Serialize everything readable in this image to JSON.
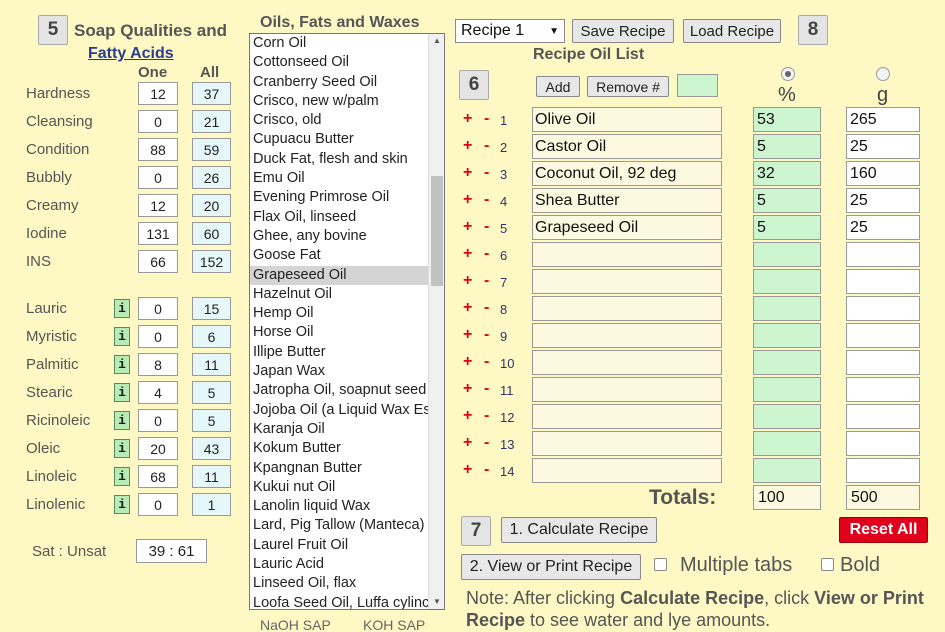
{
  "qualities": {
    "step": "5",
    "title_line1": "Soap Qualities and",
    "title_link": "Fatty Acids",
    "col_one": "One",
    "col_all": "All",
    "rows": [
      {
        "label": "Hardness",
        "one": "12",
        "all": "37"
      },
      {
        "label": "Cleansing",
        "one": "0",
        "all": "21"
      },
      {
        "label": "Condition",
        "one": "88",
        "all": "59"
      },
      {
        "label": "Bubbly",
        "one": "0",
        "all": "26"
      },
      {
        "label": "Creamy",
        "one": "12",
        "all": "20"
      },
      {
        "label": "Iodine",
        "one": "131",
        "all": "60"
      },
      {
        "label": "INS",
        "one": "66",
        "all": "152"
      }
    ],
    "acids": [
      {
        "label": "Lauric",
        "one": "0",
        "all": "15"
      },
      {
        "label": "Myristic",
        "one": "0",
        "all": "6"
      },
      {
        "label": "Palmitic",
        "one": "8",
        "all": "11"
      },
      {
        "label": "Stearic",
        "one": "4",
        "all": "5"
      },
      {
        "label": "Ricinoleic",
        "one": "0",
        "all": "5"
      },
      {
        "label": "Oleic",
        "one": "20",
        "all": "43"
      },
      {
        "label": "Linoleic",
        "one": "68",
        "all": "11"
      },
      {
        "label": "Linolenic",
        "one": "0",
        "all": "1"
      }
    ],
    "info_label": "i",
    "sat_label": "Sat : Unsat",
    "sat_value": "39 : 61"
  },
  "oils": {
    "title": "Oils, Fats and Waxes",
    "items": [
      "Corn Oil",
      "Cottonseed Oil",
      "Cranberry Seed Oil",
      "Crisco, new w/palm",
      "Crisco, old",
      "Cupuacu Butter",
      "Duck Fat, flesh and skin",
      "Emu Oil",
      "Evening Primrose Oil",
      "Flax Oil, linseed",
      "Ghee, any bovine",
      "Goose Fat",
      "Grapeseed Oil",
      "Hazelnut Oil",
      "Hemp Oil",
      "Horse Oil",
      "Illipe Butter",
      "Japan Wax",
      "Jatropha Oil, soapnut seed",
      "Jojoba Oil (a Liquid Wax Es",
      "Karanja Oil",
      "Kokum Butter",
      "Kpangnan Butter",
      "Kukui nut Oil",
      "Lanolin liquid Wax",
      "Lard, Pig Tallow (Manteca)",
      "Laurel Fruit Oil",
      "Lauric Acid",
      "Linseed Oil, flax",
      "Loofa Seed Oil, Luffa cylinc"
    ],
    "selected": "Grapeseed Oil",
    "naoh_label": "NaOH SAP",
    "koh_label": "KOH SAP"
  },
  "recipe": {
    "select_value": "Recipe 1",
    "save_label": "Save Recipe",
    "load_label": "Load Recipe",
    "step8": "8",
    "list_title": "Recipe Oil List",
    "step6": "6",
    "add_label": "Add",
    "remove_label": "Remove #",
    "pct_label": "%",
    "g_label": "g",
    "plus": "+",
    "minus": "-",
    "rows": [
      {
        "num": "1",
        "name": "Olive Oil",
        "pct": "53",
        "g": "265"
      },
      {
        "num": "2",
        "name": "Castor Oil",
        "pct": "5",
        "g": "25"
      },
      {
        "num": "3",
        "name": "Coconut Oil, 92 deg",
        "pct": "32",
        "g": "160"
      },
      {
        "num": "4",
        "name": "Shea Butter",
        "pct": "5",
        "g": "25"
      },
      {
        "num": "5",
        "name": "Grapeseed Oil",
        "pct": "5",
        "g": "25"
      },
      {
        "num": "6",
        "name": "",
        "pct": "",
        "g": ""
      },
      {
        "num": "7",
        "name": "",
        "pct": "",
        "g": ""
      },
      {
        "num": "8",
        "name": "",
        "pct": "",
        "g": ""
      },
      {
        "num": "9",
        "name": "",
        "pct": "",
        "g": ""
      },
      {
        "num": "10",
        "name": "",
        "pct": "",
        "g": ""
      },
      {
        "num": "11",
        "name": "",
        "pct": "",
        "g": ""
      },
      {
        "num": "12",
        "name": "",
        "pct": "",
        "g": ""
      },
      {
        "num": "13",
        "name": "",
        "pct": "",
        "g": ""
      },
      {
        "num": "14",
        "name": "",
        "pct": "",
        "g": ""
      }
    ],
    "totals_label": "Totals:",
    "total_pct": "100",
    "total_g": "500",
    "step7": "7",
    "calc_label": "1. Calculate Recipe",
    "reset_label": "Reset All",
    "view_label": "2. View or Print Recipe",
    "multiple_tabs_label": "Multiple tabs",
    "bold_label": "Bold",
    "note_prefix": "Note: After clicking ",
    "note_bold1": "Calculate Recipe",
    "note_mid": ", click ",
    "note_bold2": "View or Print Recipe",
    "note_suffix": " to see water and lye amounts."
  },
  "colors": {
    "accent_red": "#e0001b",
    "green_fill": "#ccf5d0",
    "page_bg": "#fdf8c4"
  }
}
